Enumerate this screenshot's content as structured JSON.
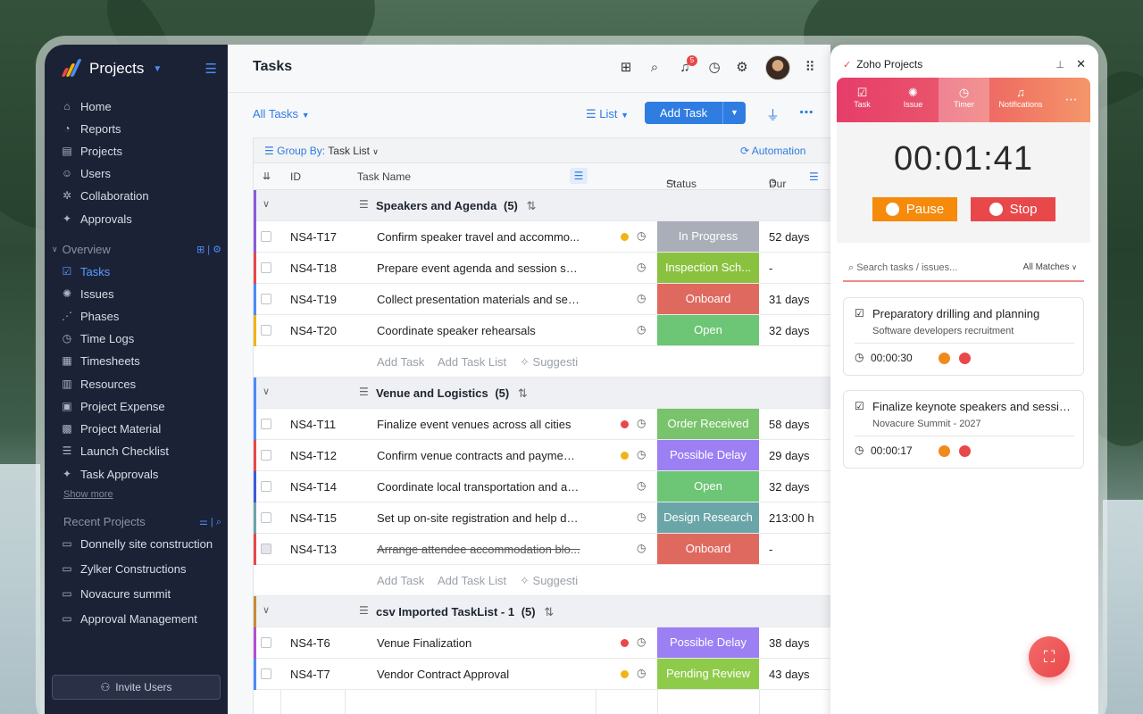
{
  "app": {
    "title": "Projects"
  },
  "sidebar": {
    "items": [
      {
        "label": "Home",
        "icon": "home-icon"
      },
      {
        "label": "Reports",
        "icon": "reports-icon"
      },
      {
        "label": "Projects",
        "icon": "projects-icon"
      },
      {
        "label": "Users",
        "icon": "users-icon"
      },
      {
        "label": "Collaboration",
        "icon": "collaboration-icon"
      },
      {
        "label": "Approvals",
        "icon": "approvals-icon"
      }
    ],
    "overview_label": "Overview",
    "overview_items": [
      {
        "label": "Tasks",
        "icon": "tasks-icon",
        "active": true
      },
      {
        "label": "Issues",
        "icon": "bug-icon"
      },
      {
        "label": "Phases",
        "icon": "phases-icon"
      },
      {
        "label": "Time Logs",
        "icon": "clock-icon"
      },
      {
        "label": "Timesheets",
        "icon": "timesheet-icon"
      },
      {
        "label": "Resources",
        "icon": "resources-icon"
      },
      {
        "label": "Project Expense",
        "icon": "expense-icon"
      },
      {
        "label": "Project Material",
        "icon": "material-icon"
      },
      {
        "label": "Launch Checklist",
        "icon": "checklist-icon"
      },
      {
        "label": "Task Approvals",
        "icon": "approval-icon"
      }
    ],
    "show_more": "Show more",
    "recent_label": "Recent Projects",
    "recent_projects": [
      "Donnelly site construction",
      "Zylker Constructions",
      "Novacure summit",
      "Approval Management"
    ],
    "invite_label": "Invite Users"
  },
  "header": {
    "title": "Tasks",
    "notification_count": "5"
  },
  "toolbar": {
    "all_tasks": "All Tasks",
    "list_label": "List",
    "add_task": "Add Task"
  },
  "grid": {
    "group_by_label": "Group By:",
    "group_by_value": "Task List",
    "automation": "Automation",
    "columns": {
      "id": "ID",
      "name": "Task Name",
      "status": "Status",
      "duration": "Dur"
    },
    "add_task": "Add Task",
    "add_task_list": "Add Task List",
    "suggest": "Suggesti",
    "groups": [
      {
        "name": "Speakers and Agenda",
        "count": "(5)"
      },
      {
        "name": "Venue and Logistics",
        "count": "(5)"
      },
      {
        "name": "csv Imported TaskList - 1",
        "count": "(5)"
      }
    ],
    "rows": [
      {
        "id": "NS4-T17",
        "name": "Confirm speaker travel and accommo...",
        "status": "In Progress",
        "duration": "52 days"
      },
      {
        "id": "NS4-T18",
        "name": "Prepare event agenda and session sch...",
        "status": "Inspection Sch...",
        "duration": "-"
      },
      {
        "id": "NS4-T19",
        "name": "Collect presentation materials and ses...",
        "status": "Onboard",
        "duration": "31 days"
      },
      {
        "id": "NS4-T20",
        "name": "Coordinate speaker rehearsals",
        "status": "Open",
        "duration": "32 days"
      },
      {
        "id": "NS4-T11",
        "name": "Finalize event venues across all cities",
        "status": "Order Received",
        "duration": "58 days"
      },
      {
        "id": "NS4-T12",
        "name": "Confirm venue contracts and payment...",
        "status": "Possible Delay",
        "duration": "29 days"
      },
      {
        "id": "NS4-T14",
        "name": "Coordinate local transportation and air...",
        "status": "Open",
        "duration": "32 days"
      },
      {
        "id": "NS4-T15",
        "name": "Set up on-site registration and help de...",
        "status": "Design Research",
        "duration": "213:00 h"
      },
      {
        "id": "NS4-T13",
        "name": "Arrange attendee accommodation blo...",
        "status": "Onboard",
        "duration": "-"
      },
      {
        "id": "NS4-T6",
        "name": "Venue Finalization",
        "status": "Possible Delay",
        "duration": "38 days"
      },
      {
        "id": "NS4-T7",
        "name": "Vendor Contract Approval",
        "status": "Pending Review",
        "duration": "43 days"
      }
    ]
  },
  "colors": {
    "in_progress": "#a9aeb8",
    "inspection": "#8ac23f",
    "onboard": "#e0695f",
    "open": "#6cc675",
    "order_received": "#78c36b",
    "possible_delay": "#9b7ff3",
    "design_research": "#6aa5a8",
    "pending_review": "#8fcb4b",
    "accent": "#2f7de1"
  },
  "panel": {
    "title": "Zoho Projects",
    "tabs": [
      "Task",
      "Issue",
      "Timer",
      "Notifications"
    ],
    "timer": "00:01:41",
    "pause": "Pause",
    "stop": "Stop",
    "search_placeholder": "Search tasks / issues...",
    "matches": "All Matches",
    "cards": [
      {
        "title": "Preparatory drilling and planning",
        "subtitle": "Software developers recruitment",
        "time": "00:00:30"
      },
      {
        "title": "Finalize keynote speakers and session...",
        "subtitle": "Novacure Summit - 2027",
        "time": "00:00:17"
      }
    ]
  }
}
